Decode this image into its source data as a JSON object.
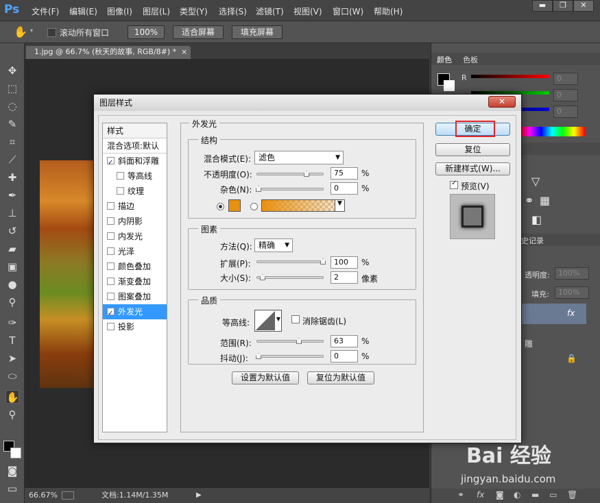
{
  "app": {
    "logo": "Ps",
    "menu": [
      "文件(F)",
      "编辑(E)",
      "图像(I)",
      "图层(L)",
      "类型(Y)",
      "选择(S)",
      "滤镜(T)",
      "视图(V)",
      "窗口(W)",
      "帮助(H)"
    ],
    "window_controls": [
      "▬",
      "❐",
      "✕"
    ]
  },
  "options_bar": {
    "scroll_all": "滚动所有窗口",
    "zoom_100": "100%",
    "fit_screen": "适合屏幕",
    "fill_screen": "填充屏幕"
  },
  "document": {
    "tab_title": "1.jpg @ 66.7% (秋天的故事, RGB/8#) *",
    "tab_close": "×",
    "zoom": "66.67%",
    "doc_size": "文档:1.14M/1.35M"
  },
  "right_panel": {
    "tabs": [
      "颜色",
      "色板"
    ],
    "rgb_labels": [
      "R",
      "G",
      "B"
    ],
    "rgb_values": [
      "0",
      "0",
      "0"
    ],
    "history_tab": "史记录",
    "opacity_label": "透明度:",
    "opacity_value": "100%",
    "fill_label": "填充:",
    "fill_value": "100%",
    "fx_label": "fx",
    "layer_name_fragment": "雕"
  },
  "dialog": {
    "title": "图层样式",
    "close": "✕",
    "style_list": {
      "header": "样式",
      "blend_options": "混合选项:默认",
      "items": [
        {
          "label": "斜面和浮雕",
          "checked": true,
          "indent": false
        },
        {
          "label": "等高线",
          "checked": false,
          "indent": true
        },
        {
          "label": "纹理",
          "checked": false,
          "indent": true
        },
        {
          "label": "描边",
          "checked": false,
          "indent": false
        },
        {
          "label": "内阴影",
          "checked": false,
          "indent": false
        },
        {
          "label": "内发光",
          "checked": false,
          "indent": false
        },
        {
          "label": "光泽",
          "checked": false,
          "indent": false
        },
        {
          "label": "颜色叠加",
          "checked": false,
          "indent": false
        },
        {
          "label": "渐变叠加",
          "checked": false,
          "indent": false
        },
        {
          "label": "图案叠加",
          "checked": false,
          "indent": false
        },
        {
          "label": "外发光",
          "checked": true,
          "indent": false,
          "selected": true
        },
        {
          "label": "投影",
          "checked": false,
          "indent": false
        }
      ]
    },
    "section_title": "外发光",
    "structure": {
      "title": "结构",
      "blend_mode_label": "混合模式(E):",
      "blend_mode_value": "滤色",
      "opacity_label": "不透明度(O):",
      "opacity_value": "75",
      "noise_label": "杂色(N):",
      "noise_value": "0",
      "percent": "%",
      "glow_color": "#e8900f"
    },
    "elements": {
      "title": "图素",
      "method_label": "方法(Q):",
      "method_value": "精确",
      "spread_label": "扩展(P):",
      "spread_value": "100",
      "size_label": "大小(S):",
      "size_value": "2",
      "size_unit": "像素",
      "percent": "%"
    },
    "quality": {
      "title": "品质",
      "contour_label": "等高线:",
      "antialias_label": "消除锯齿(L)",
      "range_label": "范围(R):",
      "range_value": "63",
      "jitter_label": "抖动(J):",
      "jitter_value": "0",
      "percent": "%"
    },
    "set_default": "设置为默认值",
    "reset_default": "复位为默认值",
    "ok": "确定",
    "reset": "复位",
    "new_style": "新建样式(W)...",
    "preview_label": "预览(V)",
    "highlight_color": "#e0242a"
  },
  "watermark": {
    "logo": "Bai 经验",
    "url": "jingyan.baidu.com"
  }
}
